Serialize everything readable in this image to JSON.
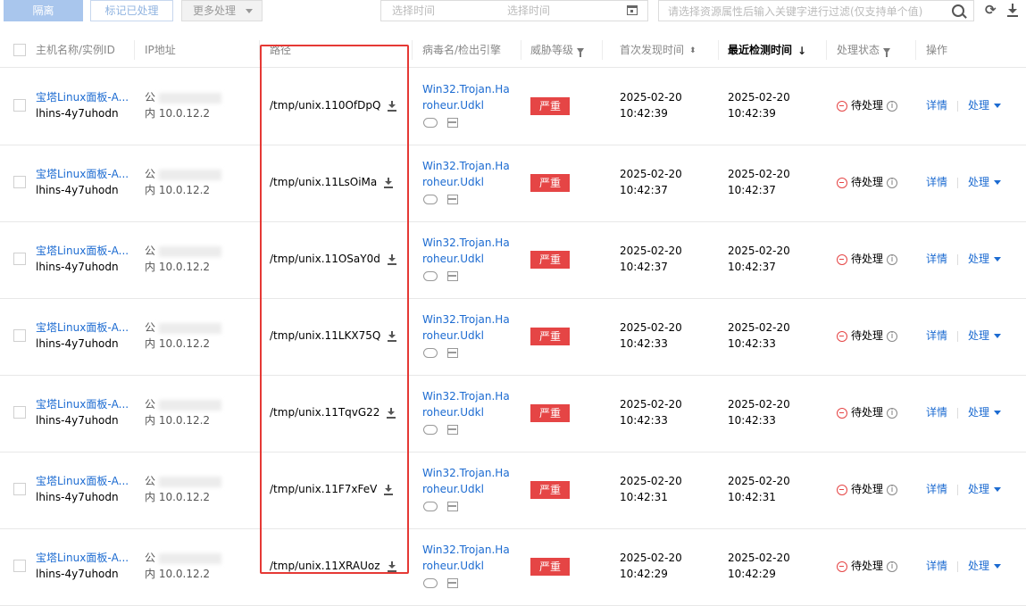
{
  "toolbar": {
    "isolate_label": "隔离",
    "mark_processed_label": "标记已处理",
    "more_label": "更多处理",
    "date_start_placeholder": "选择时间",
    "date_end_placeholder": "选择时间",
    "search_placeholder": "请选择资源属性后输入关键字进行过滤(仅支持单个值)",
    "icons": [
      "calendar-icon",
      "search-icon",
      "refresh-icon",
      "download-icon"
    ]
  },
  "columns": {
    "host": "主机名称/实例ID",
    "ip": "IP地址",
    "path": "路径",
    "virus": "病毒名/检出引擎",
    "threat": "威胁等级",
    "first_found": "首次发现时间",
    "last_checked": "最近检测时间",
    "status": "处理状态",
    "ops": "操作"
  },
  "rows": [
    {
      "host_name": "宝塔Linux面板-A...",
      "instance_id": "lhins-4y7uhodn",
      "ip_public_prefix": "公",
      "ip_private": "内 10.0.12.2",
      "path": "/tmp/unix.110OfDpQ",
      "virus_line1": "Win32.Trojan.Ha",
      "virus_line2": "roheur.Udkl",
      "threat": "严重",
      "first_date": "2025-02-20",
      "first_time": "10:42:39",
      "last_date": "2025-02-20",
      "last_time": "10:42:39",
      "status": "待处理",
      "detail": "详情",
      "handle": "处理"
    },
    {
      "host_name": "宝塔Linux面板-A...",
      "instance_id": "lhins-4y7uhodn",
      "ip_public_prefix": "公",
      "ip_private": "内 10.0.12.2",
      "path": "/tmp/unix.11LsOiMa",
      "virus_line1": "Win32.Trojan.Ha",
      "virus_line2": "roheur.Udkl",
      "threat": "严重",
      "first_date": "2025-02-20",
      "first_time": "10:42:37",
      "last_date": "2025-02-20",
      "last_time": "10:42:37",
      "status": "待处理",
      "detail": "详情",
      "handle": "处理"
    },
    {
      "host_name": "宝塔Linux面板-A...",
      "instance_id": "lhins-4y7uhodn",
      "ip_public_prefix": "公",
      "ip_private": "内 10.0.12.2",
      "path": "/tmp/unix.11OSaY0d",
      "virus_line1": "Win32.Trojan.Ha",
      "virus_line2": "roheur.Udkl",
      "threat": "严重",
      "first_date": "2025-02-20",
      "first_time": "10:42:37",
      "last_date": "2025-02-20",
      "last_time": "10:42:37",
      "status": "待处理",
      "detail": "详情",
      "handle": "处理"
    },
    {
      "host_name": "宝塔Linux面板-A...",
      "instance_id": "lhins-4y7uhodn",
      "ip_public_prefix": "公",
      "ip_private": "内 10.0.12.2",
      "path": "/tmp/unix.11LKX75Q",
      "virus_line1": "Win32.Trojan.Ha",
      "virus_line2": "roheur.Udkl",
      "threat": "严重",
      "first_date": "2025-02-20",
      "first_time": "10:42:33",
      "last_date": "2025-02-20",
      "last_time": "10:42:33",
      "status": "待处理",
      "detail": "详情",
      "handle": "处理"
    },
    {
      "host_name": "宝塔Linux面板-A...",
      "instance_id": "lhins-4y7uhodn",
      "ip_public_prefix": "公",
      "ip_private": "内 10.0.12.2",
      "path": "/tmp/unix.11TqvG22",
      "virus_line1": "Win32.Trojan.Ha",
      "virus_line2": "roheur.Udkl",
      "threat": "严重",
      "first_date": "2025-02-20",
      "first_time": "10:42:33",
      "last_date": "2025-02-20",
      "last_time": "10:42:33",
      "status": "待处理",
      "detail": "详情",
      "handle": "处理"
    },
    {
      "host_name": "宝塔Linux面板-A...",
      "instance_id": "lhins-4y7uhodn",
      "ip_public_prefix": "公",
      "ip_private": "内 10.0.12.2",
      "path": "/tmp/unix.11F7xFeV",
      "virus_line1": "Win32.Trojan.Ha",
      "virus_line2": "roheur.Udkl",
      "threat": "严重",
      "first_date": "2025-02-20",
      "first_time": "10:42:31",
      "last_date": "2025-02-20",
      "last_time": "10:42:31",
      "status": "待处理",
      "detail": "详情",
      "handle": "处理"
    },
    {
      "host_name": "宝塔Linux面板-A...",
      "instance_id": "lhins-4y7uhodn",
      "ip_public_prefix": "公",
      "ip_private": "内 10.0.12.2",
      "path": "/tmp/unix.11XRAUoz",
      "virus_line1": "Win32.Trojan.Ha",
      "virus_line2": "roheur.Udkl",
      "threat": "严重",
      "first_date": "2025-02-20",
      "first_time": "10:42:29",
      "last_date": "2025-02-20",
      "last_time": "10:42:29",
      "status": "待处理",
      "detail": "详情",
      "handle": "处理"
    }
  ],
  "colors": {
    "link": "#1c6bd1",
    "severe": "#e54545",
    "highlight": "#e53935"
  }
}
